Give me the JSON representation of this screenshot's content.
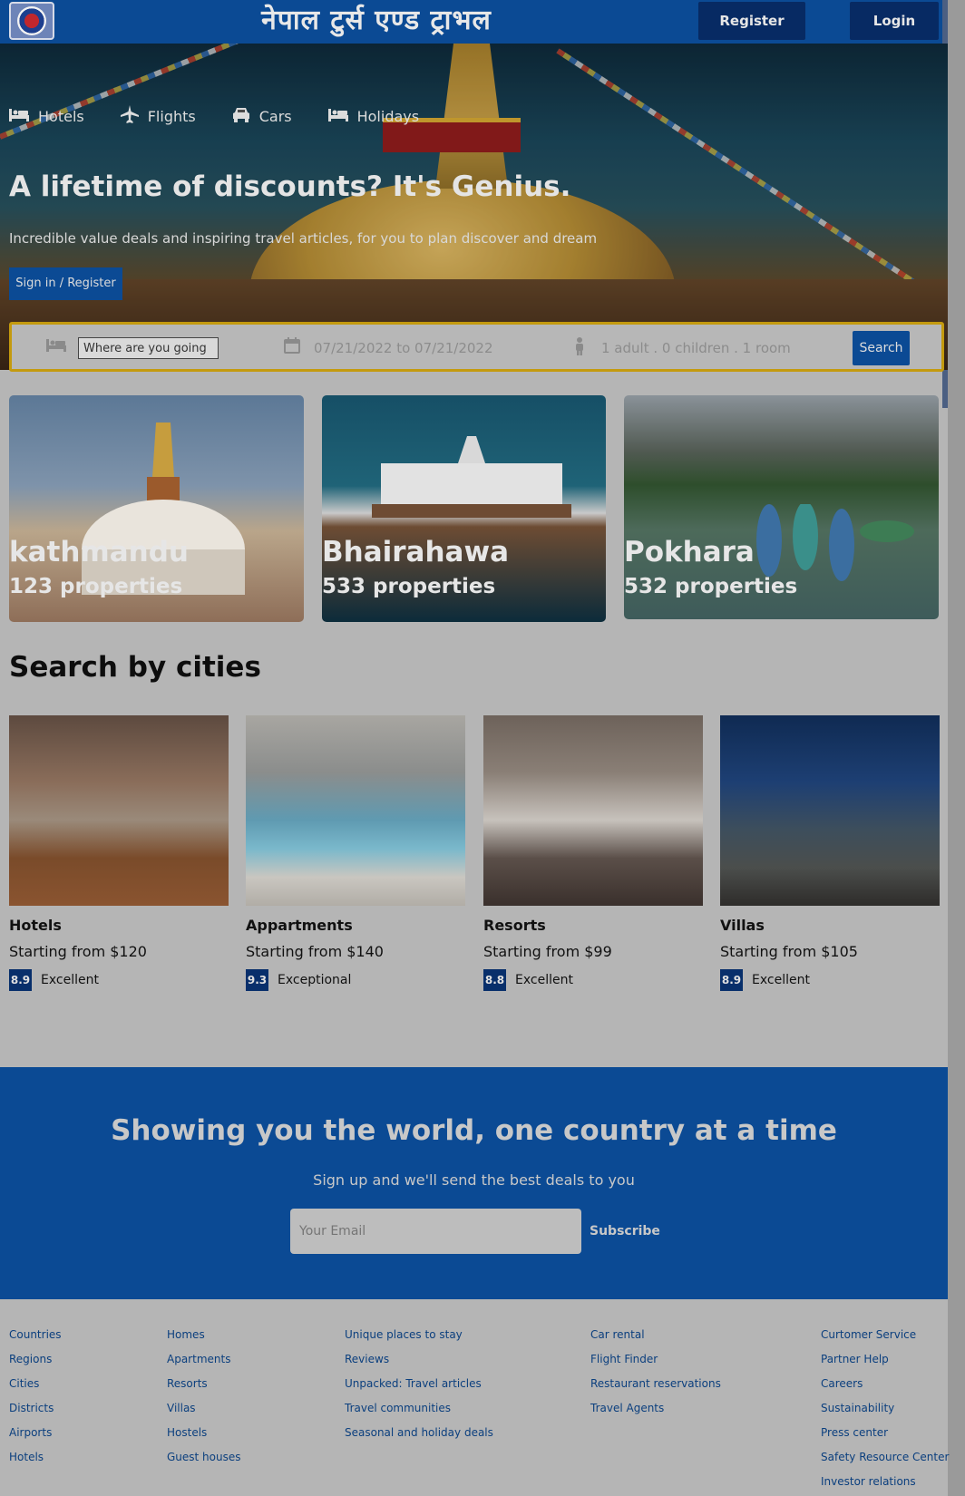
{
  "header": {
    "site_title": "नेपाल टुर्स एण्ड ट्राभल",
    "register_label": "Register",
    "login_label": "Login"
  },
  "nav": {
    "items": [
      {
        "label": "Hotels",
        "icon": "bed-icon"
      },
      {
        "label": "Flights",
        "icon": "airplane-icon"
      },
      {
        "label": "Cars",
        "icon": "car-icon"
      },
      {
        "label": "Holidays",
        "icon": "bed-icon"
      }
    ]
  },
  "hero": {
    "headline": "A lifetime of discounts? It's Genius.",
    "subtext": "Incredible value deals and inspiring travel articles, for you to plan discover and dream",
    "signin_label": "Sign in / Register"
  },
  "search": {
    "destination_value": "Where are you going",
    "dates": "07/21/2022 to 07/21/2022",
    "guests": "1 adult . 0 children . 1 room",
    "button_label": "Search"
  },
  "destinations": [
    {
      "name": "kathmandu",
      "properties": "123 properties"
    },
    {
      "name": "Bhairahawa",
      "properties": "533 properties"
    },
    {
      "name": "Pokhara",
      "properties": "532 properties"
    }
  ],
  "section_title": "Search by cities",
  "property_types": [
    {
      "title": "Hotels",
      "price": "Starting from $120",
      "score": "8.9",
      "rating": "Excellent"
    },
    {
      "title": "Appartments",
      "price": "Starting from $140",
      "score": "9.3",
      "rating": "Exceptional"
    },
    {
      "title": "Resorts",
      "price": "Starting from $99",
      "score": "8.8",
      "rating": "Excellent"
    },
    {
      "title": "Villas",
      "price": "Starting from $105",
      "score": "8.9",
      "rating": "Excellent"
    }
  ],
  "newsletter": {
    "title": "Showing you the world, one country at a time",
    "subtitle": "Sign up and we'll send the best deals to you",
    "email_placeholder": "Your Email",
    "subscribe_label": "Subscribe"
  },
  "footer": {
    "columns": [
      [
        "Countries",
        "Regions",
        "Cities",
        "Districts",
        "Airports",
        "Hotels"
      ],
      [
        "Homes",
        "Apartments",
        "Resorts",
        "Villas",
        "Hostels",
        "Guest houses"
      ],
      [
        "Unique places to stay",
        "Reviews",
        "Unpacked: Travel articles",
        "Travel communities",
        "Seasonal and holiday deals"
      ],
      [
        "Car rental",
        "Flight Finder",
        "Restaurant reservations",
        "Travel Agents"
      ],
      [
        "Curtomer Service",
        "Partner Help",
        "Careers",
        "Sustainability",
        "Press center",
        "Safety Resource Center",
        "Investor relations"
      ]
    ]
  },
  "colors": {
    "brand_blue": "#0b4a94",
    "dark_blue": "#072a63",
    "search_border": "#c49a0e",
    "page_bg": "#b5b5b5"
  }
}
